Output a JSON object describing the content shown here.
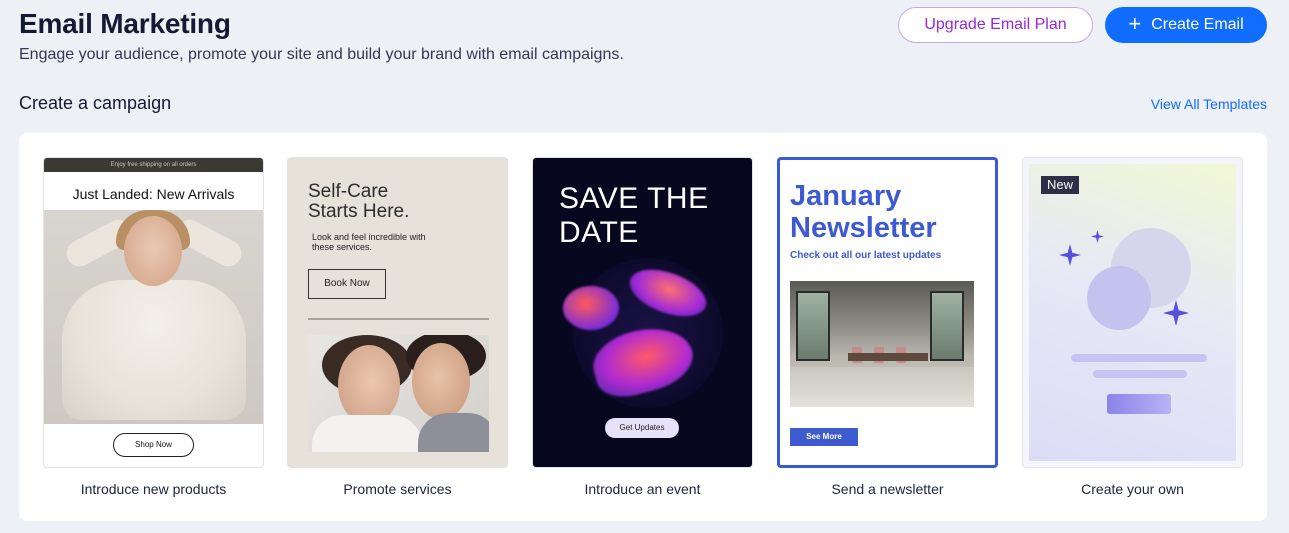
{
  "header": {
    "title": "Email Marketing",
    "subtitle": "Engage your audience, promote your site and build your brand with email campaigns.",
    "upgrade_label": "Upgrade Email Plan",
    "create_label": "Create Email",
    "create_icon": "+"
  },
  "section": {
    "title": "Create a campaign",
    "view_all_label": "View All Templates"
  },
  "cards": [
    {
      "label": "Introduce new products",
      "topbar": "Enjoy free shipping on all orders",
      "headline": "Just Landed: New Arrivals",
      "button": "Shop Now"
    },
    {
      "label": "Promote services",
      "headline": "Self-Care Starts Here.",
      "body": "Look and feel incredible with these services.",
      "button": "Book Now"
    },
    {
      "label": "Introduce an event",
      "headline": "SAVE THE DATE",
      "button": "Get Updates"
    },
    {
      "label": "Send a newsletter",
      "headline": "January Newsletter",
      "subhead": "Check out all our latest updates",
      "button": "See More"
    },
    {
      "label": "Create your own",
      "badge": "New"
    }
  ],
  "colors": {
    "background": "#edf0f5",
    "primary": "#116dff",
    "upgrade_text": "#9a27d5",
    "newsletter_blue": "#3d5ad1"
  }
}
